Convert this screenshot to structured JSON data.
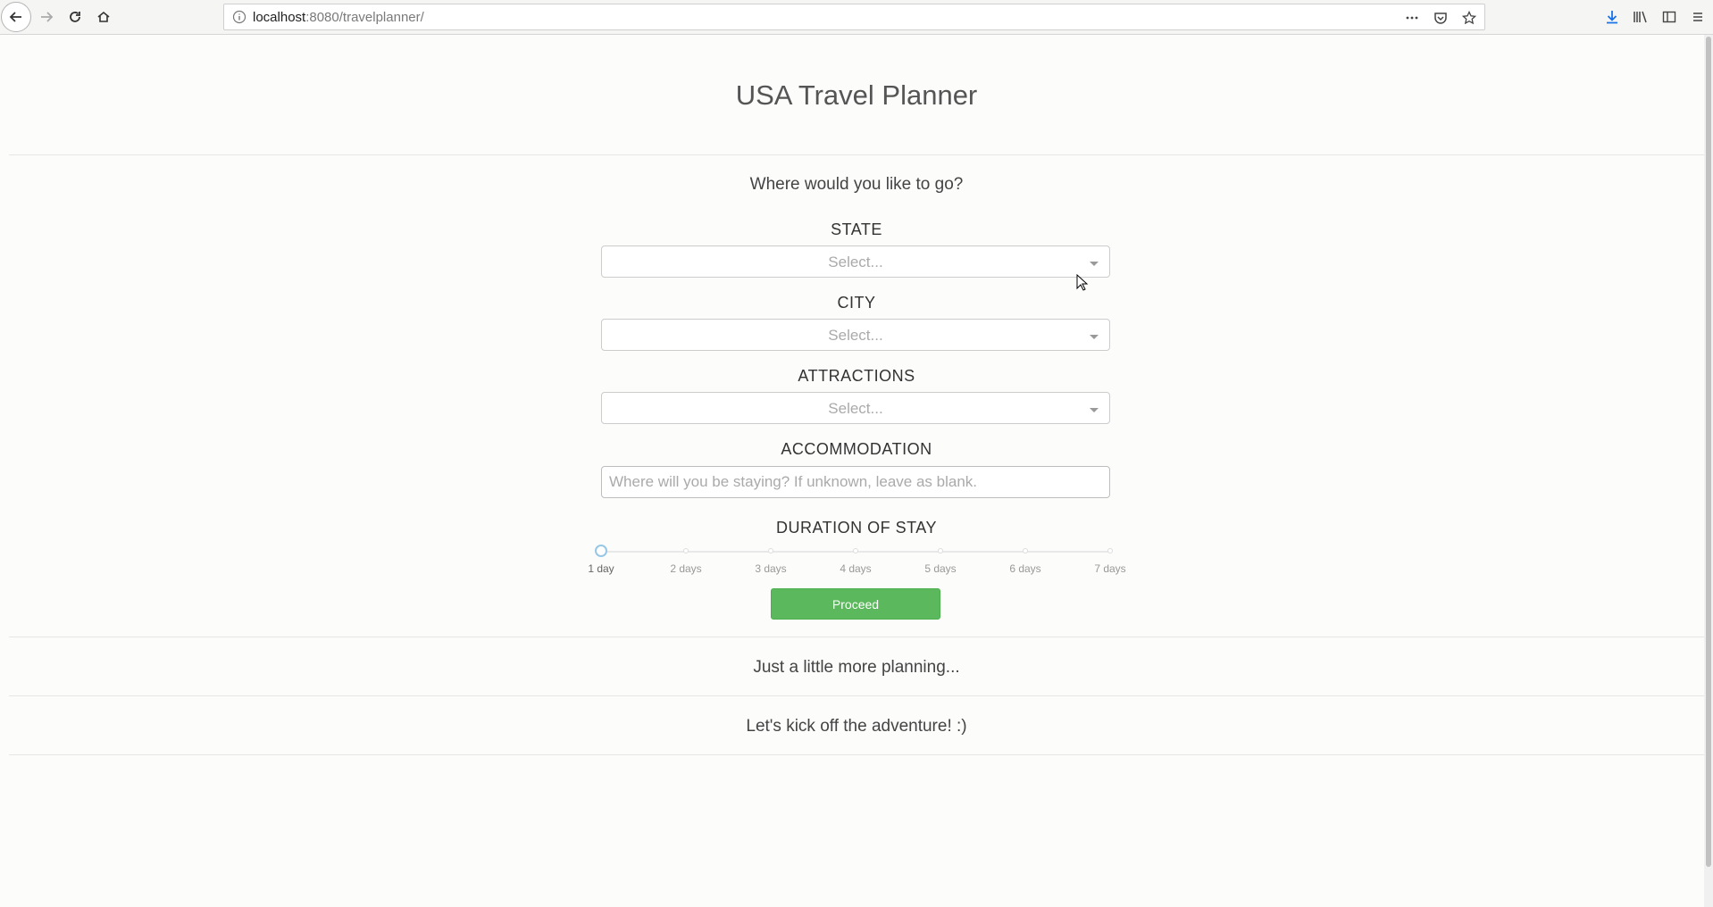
{
  "browser": {
    "url_host": "localhost",
    "url_rest": ":8080/travelplanner/"
  },
  "page": {
    "title": "USA Travel Planner",
    "sections": {
      "where": "Where would you like to go?",
      "planning": "Just a little more planning...",
      "kickoff": "Let's kick off the adventure! :)"
    },
    "state": {
      "label": "STATE",
      "placeholder": "Select..."
    },
    "city": {
      "label": "CITY",
      "placeholder": "Select..."
    },
    "attractions": {
      "label": "ATTRACTIONS",
      "placeholder": "Select..."
    },
    "accommodation": {
      "label": "ACCOMMODATION",
      "placeholder": "Where will you be staying? If unknown, leave as blank.",
      "value": ""
    },
    "duration": {
      "label": "DURATION OF STAY",
      "marks": [
        "1 day",
        "2 days",
        "3 days",
        "4 days",
        "5 days",
        "6 days",
        "7 days"
      ],
      "selected_index": 0
    },
    "proceed_label": "Proceed"
  },
  "colors": {
    "proceed_green": "#5cb85c",
    "slider_handle": "#96c8e6"
  }
}
